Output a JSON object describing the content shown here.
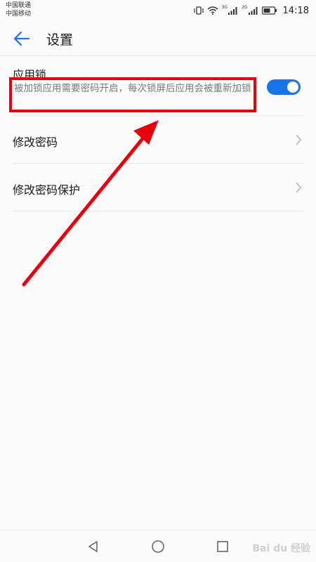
{
  "status_bar": {
    "carrier_1": "中国联通",
    "carrier_2": "中国移动",
    "net_1": "3G",
    "net_2": "2G",
    "time": "14:18"
  },
  "header": {
    "back_icon": "arrow-left-icon",
    "title": "设置"
  },
  "settings": {
    "app_lock": {
      "title": "应用锁",
      "description": "被加锁应用需要密码开启，每次锁屏后应用会被重新加锁",
      "enabled": true
    },
    "items": [
      {
        "label": "修改密码",
        "icon": "chevron-right-icon"
      },
      {
        "label": "修改密码保护",
        "icon": "chevron-right-icon"
      }
    ]
  },
  "nav_bar": {
    "back_icon": "triangle-back-icon",
    "home_icon": "circle-home-icon",
    "recent_icon": "square-recent-icon"
  },
  "watermark": "Bai du 经验",
  "colors": {
    "accent": "#1a73e8",
    "annotation": "#e8000d"
  }
}
